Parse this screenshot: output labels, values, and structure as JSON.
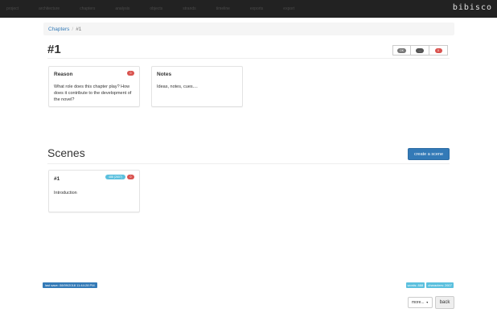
{
  "navbar": {
    "items": [
      "project",
      "architecture",
      "chapters",
      "analysis",
      "objects",
      "strands",
      "timeline",
      "exports",
      "export"
    ],
    "brand": "bibisco"
  },
  "breadcrumb": {
    "parent": "Chapters",
    "separator": "/",
    "current": "#1"
  },
  "page": {
    "title": "#1",
    "button_group": [
      "OK",
      "...",
      "0"
    ]
  },
  "cards": {
    "reason": {
      "title": "Reason",
      "badge": "0",
      "body": "What role does this chapter play? How does it contribute to the development of the novel?"
    },
    "notes": {
      "title": "Notes",
      "body": "Ideas, notes, cues...."
    }
  },
  "scenes": {
    "title": "Scenes",
    "create_label": "create a scene",
    "items": [
      {
        "title": "#1",
        "words_badge": "488 (2607)",
        "status_badge": "0",
        "body": "Introduction"
      }
    ]
  },
  "footer": {
    "last_save": "last save: 08/09/2018 11:44:28 PM",
    "words": "words: 888",
    "characters": "characters: 2607",
    "more_label": "more...",
    "back_label": "back"
  },
  "colors": {
    "navbar": "#222222",
    "primary": "#337ab7",
    "info": "#5bc0de",
    "danger": "#d9534f"
  }
}
